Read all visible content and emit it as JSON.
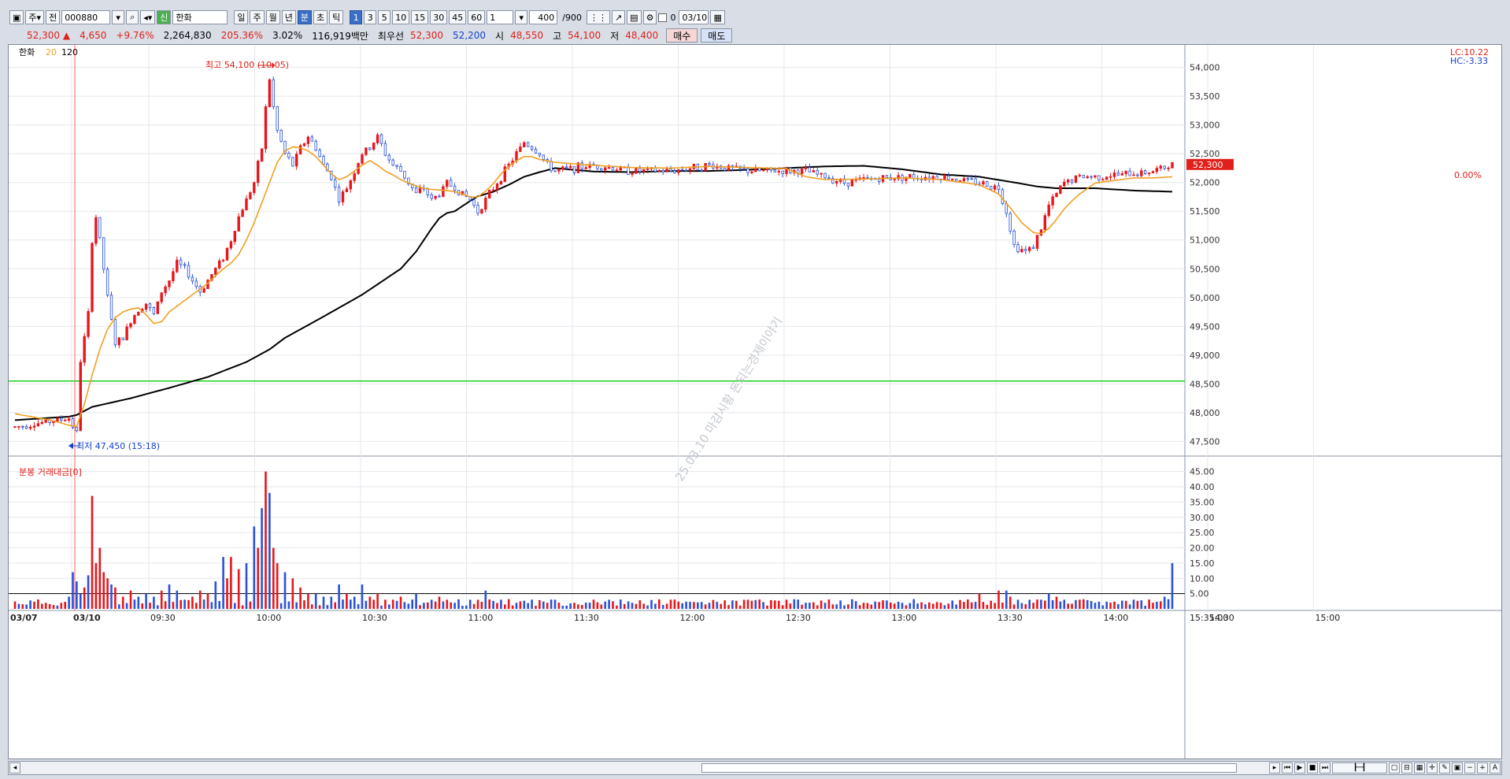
{
  "toolbar": {
    "period_type": "주",
    "mode": "전",
    "code": "000880",
    "name_tag": "신",
    "stock_name": "한화",
    "periods": [
      "일",
      "주",
      "월",
      "년",
      "분",
      "초",
      "틱"
    ],
    "active_period": "분",
    "intervals": [
      "1",
      "3",
      "5",
      "10",
      "15",
      "30",
      "45",
      "60"
    ],
    "active_interval": "1",
    "interval_select": "1",
    "count": "400",
    "count_total": "/900",
    "checkbox_label": "0",
    "date": "03/10"
  },
  "quote": {
    "price": "52,300",
    "arrow": "▲",
    "change": "4,650",
    "change_pct": "+9.76%",
    "volume": "2,264,830",
    "volume_ratio": "205.36%",
    "turnover": "3.02%",
    "amount": "116,919백만",
    "best_label": "최우선",
    "best_ask": "52,300",
    "best_bid": "52,200",
    "open_label": "시",
    "open": "48,550",
    "high_label": "고",
    "high": "54,100",
    "low_label": "저",
    "low": "48,400",
    "buy_label": "매수",
    "sell_label": "매도"
  },
  "legend": {
    "name": "한화",
    "ma_short": "20",
    "ma_long": "120"
  },
  "annotations": {
    "high": "최고 54,100 (10:05)",
    "low": "최저 47,450 (15:18)",
    "lc": "LC:10.22",
    "hc": "HC:-3.33",
    "current_price": "52,300",
    "current_pct": "0.00%",
    "watermark": "25.03.10 마감시황 돈되는경제이야기"
  },
  "volume_panel": {
    "title": "분봉 거래대금[0]"
  },
  "colors": {
    "up": "#e8161a",
    "down": "#2a52d8",
    "ma_short": "#f0a020",
    "ma_long": "#000000",
    "hline": "#19d219"
  },
  "chart_data": {
    "type": "candlestick",
    "price_axis": {
      "ticks": [
        "54,000",
        "53,500",
        "53,000",
        "52,500",
        "52,000",
        "51,500",
        "51,000",
        "50,500",
        "50,000",
        "49,500",
        "49,000",
        "48,500",
        "48,000",
        "47,500"
      ],
      "ylim": [
        47300,
        54200
      ]
    },
    "volume_axis": {
      "ticks": [
        "45.00",
        "40.00",
        "35.00",
        "30.00",
        "25.00",
        "20.00",
        "15.00",
        "10.00",
        "5.00"
      ],
      "ylim": [
        0,
        48
      ]
    },
    "time_labels": [
      "03/07",
      "03/10",
      "09:30",
      "10:00",
      "10:30",
      "11:00",
      "11:30",
      "12:00",
      "12:30",
      "13:00",
      "13:30",
      "14:00",
      "14:30",
      "15:00",
      "15:35:00"
    ],
    "horizontal_line": 48550,
    "volume_reference_line": 5,
    "high_marker": {
      "time": "10:05",
      "price": 54100
    },
    "low_marker": {
      "time": "15:18",
      "price": 47450
    },
    "close_path": [
      [
        0,
        47750
      ],
      [
        14,
        47900
      ],
      [
        16,
        47650
      ],
      [
        17,
        48900
      ],
      [
        18,
        49300
      ],
      [
        19,
        49700
      ],
      [
        20,
        51000
      ],
      [
        21,
        51400
      ],
      [
        22,
        51000
      ],
      [
        23,
        50500
      ],
      [
        24,
        50000
      ],
      [
        26,
        49200
      ],
      [
        28,
        49300
      ],
      [
        30,
        49600
      ],
      [
        32,
        49800
      ],
      [
        34,
        49900
      ],
      [
        36,
        49700
      ],
      [
        38,
        50100
      ],
      [
        40,
        50300
      ],
      [
        42,
        50600
      ],
      [
        44,
        50500
      ],
      [
        46,
        50300
      ],
      [
        48,
        50100
      ],
      [
        50,
        50300
      ],
      [
        52,
        50500
      ],
      [
        54,
        50700
      ],
      [
        56,
        51000
      ],
      [
        58,
        51400
      ],
      [
        60,
        51700
      ],
      [
        62,
        52000
      ],
      [
        63,
        52300
      ],
      [
        64,
        52600
      ],
      [
        65,
        53300
      ],
      [
        66,
        53800
      ],
      [
        67,
        53300
      ],
      [
        68,
        52900
      ],
      [
        70,
        52500
      ],
      [
        72,
        52300
      ],
      [
        74,
        52600
      ],
      [
        76,
        52800
      ],
      [
        78,
        52600
      ],
      [
        80,
        52300
      ],
      [
        82,
        52100
      ],
      [
        84,
        51700
      ],
      [
        86,
        51900
      ],
      [
        88,
        52200
      ],
      [
        90,
        52500
      ],
      [
        92,
        52600
      ],
      [
        94,
        52800
      ],
      [
        96,
        52500
      ],
      [
        98,
        52300
      ],
      [
        100,
        52200
      ],
      [
        102,
        52000
      ],
      [
        104,
        51800
      ],
      [
        106,
        51900
      ],
      [
        108,
        51700
      ],
      [
        110,
        51800
      ],
      [
        112,
        52000
      ],
      [
        114,
        51900
      ],
      [
        116,
        51800
      ],
      [
        118,
        51700
      ],
      [
        120,
        51500
      ],
      [
        122,
        51700
      ],
      [
        124,
        51900
      ],
      [
        126,
        52100
      ],
      [
        128,
        52300
      ],
      [
        130,
        52500
      ],
      [
        132,
        52700
      ],
      [
        134,
        52600
      ],
      [
        136,
        52500
      ],
      [
        138,
        52300
      ],
      [
        140,
        52200
      ],
      [
        150,
        52300
      ],
      [
        160,
        52200
      ],
      [
        170,
        52200
      ],
      [
        180,
        52300
      ],
      [
        190,
        52200
      ],
      [
        200,
        52200
      ],
      [
        205,
        52200
      ],
      [
        210,
        52100
      ],
      [
        215,
        52000
      ],
      [
        220,
        52050
      ],
      [
        230,
        52100
      ],
      [
        240,
        52100
      ],
      [
        250,
        52000
      ],
      [
        255,
        51900
      ],
      [
        257,
        51500
      ],
      [
        258,
        51200
      ],
      [
        259,
        50900
      ],
      [
        262,
        50800
      ],
      [
        264,
        50900
      ],
      [
        266,
        51200
      ],
      [
        268,
        51600
      ],
      [
        270,
        51800
      ],
      [
        272,
        52000
      ],
      [
        276,
        52100
      ],
      [
        280,
        52100
      ],
      [
        290,
        52150
      ],
      [
        295,
        52200
      ],
      [
        300,
        52300
      ]
    ],
    "ma20_path": [
      [
        0,
        47980
      ],
      [
        10,
        47860
      ],
      [
        14,
        47780
      ],
      [
        16,
        47760
      ],
      [
        18,
        48150
      ],
      [
        20,
        48650
      ],
      [
        22,
        49100
      ],
      [
        24,
        49450
      ],
      [
        26,
        49650
      ],
      [
        28,
        49750
      ],
      [
        30,
        49800
      ],
      [
        32,
        49820
      ],
      [
        34,
        49700
      ],
      [
        36,
        49550
      ],
      [
        38,
        49580
      ],
      [
        40,
        49750
      ],
      [
        42,
        49850
      ],
      [
        44,
        49950
      ],
      [
        46,
        50050
      ],
      [
        48,
        50150
      ],
      [
        50,
        50250
      ],
      [
        52,
        50380
      ],
      [
        54,
        50500
      ],
      [
        56,
        50600
      ],
      [
        58,
        50750
      ],
      [
        60,
        51000
      ],
      [
        62,
        51300
      ],
      [
        64,
        51650
      ],
      [
        66,
        52000
      ],
      [
        68,
        52350
      ],
      [
        70,
        52550
      ],
      [
        72,
        52620
      ],
      [
        74,
        52600
      ],
      [
        76,
        52550
      ],
      [
        78,
        52450
      ],
      [
        80,
        52300
      ],
      [
        82,
        52150
      ],
      [
        84,
        52050
      ],
      [
        86,
        52100
      ],
      [
        88,
        52200
      ],
      [
        90,
        52300
      ],
      [
        92,
        52380
      ],
      [
        94,
        52300
      ],
      [
        96,
        52200
      ],
      [
        98,
        52130
      ],
      [
        100,
        52050
      ],
      [
        102,
        51990
      ],
      [
        104,
        51940
      ],
      [
        106,
        51900
      ],
      [
        108,
        51880
      ],
      [
        110,
        51870
      ],
      [
        112,
        51860
      ],
      [
        114,
        51840
      ],
      [
        116,
        51800
      ],
      [
        118,
        51750
      ],
      [
        120,
        51750
      ],
      [
        122,
        51850
      ],
      [
        124,
        51980
      ],
      [
        126,
        52150
      ],
      [
        128,
        52280
      ],
      [
        130,
        52380
      ],
      [
        132,
        52450
      ],
      [
        134,
        52450
      ],
      [
        136,
        52400
      ],
      [
        140,
        52350
      ],
      [
        150,
        52300
      ],
      [
        160,
        52260
      ],
      [
        170,
        52250
      ],
      [
        180,
        52280
      ],
      [
        190,
        52260
      ],
      [
        200,
        52240
      ],
      [
        205,
        52100
      ],
      [
        210,
        52050
      ],
      [
        220,
        52060
      ],
      [
        230,
        52080
      ],
      [
        240,
        52050
      ],
      [
        250,
        51960
      ],
      [
        255,
        51800
      ],
      [
        258,
        51560
      ],
      [
        261,
        51300
      ],
      [
        264,
        51130
      ],
      [
        266,
        51110
      ],
      [
        268,
        51200
      ],
      [
        270,
        51360
      ],
      [
        272,
        51540
      ],
      [
        274,
        51680
      ],
      [
        276,
        51800
      ],
      [
        280,
        51990
      ],
      [
        290,
        52080
      ],
      [
        295,
        52080
      ],
      [
        300,
        52100
      ]
    ],
    "ma120_path": [
      [
        0,
        47870
      ],
      [
        14,
        47930
      ],
      [
        16,
        47960
      ],
      [
        20,
        48100
      ],
      [
        30,
        48250
      ],
      [
        40,
        48430
      ],
      [
        50,
        48620
      ],
      [
        60,
        48880
      ],
      [
        66,
        49100
      ],
      [
        70,
        49300
      ],
      [
        80,
        49670
      ],
      [
        90,
        50050
      ],
      [
        100,
        50500
      ],
      [
        104,
        50800
      ],
      [
        106,
        51000
      ],
      [
        108,
        51200
      ],
      [
        110,
        51380
      ],
      [
        112,
        51470
      ],
      [
        114,
        51500
      ],
      [
        118,
        51680
      ],
      [
        120,
        51760
      ],
      [
        124,
        51840
      ],
      [
        128,
        51960
      ],
      [
        132,
        52100
      ],
      [
        136,
        52180
      ],
      [
        140,
        52250
      ],
      [
        150,
        52190
      ],
      [
        160,
        52180
      ],
      [
        170,
        52200
      ],
      [
        180,
        52200
      ],
      [
        190,
        52220
      ],
      [
        200,
        52250
      ],
      [
        210,
        52280
      ],
      [
        220,
        52290
      ],
      [
        230,
        52230
      ],
      [
        240,
        52140
      ],
      [
        250,
        52100
      ],
      [
        260,
        51990
      ],
      [
        265,
        51930
      ],
      [
        270,
        51900
      ],
      [
        280,
        51900
      ],
      [
        290,
        51860
      ],
      [
        300,
        51840
      ]
    ],
    "volume_peaks": [
      [
        14,
        4
      ],
      [
        15,
        12
      ],
      [
        16,
        9
      ],
      [
        17,
        5
      ],
      [
        18,
        7
      ],
      [
        19,
        11
      ],
      [
        20,
        37
      ],
      [
        21,
        15
      ],
      [
        22,
        20
      ],
      [
        23,
        12
      ],
      [
        24,
        10
      ],
      [
        25,
        8
      ],
      [
        26,
        7
      ],
      [
        28,
        4
      ],
      [
        30,
        6
      ],
      [
        32,
        4
      ],
      [
        34,
        5
      ],
      [
        36,
        4
      ],
      [
        38,
        6
      ],
      [
        40,
        8
      ],
      [
        42,
        6
      ],
      [
        44,
        3
      ],
      [
        46,
        4
      ],
      [
        48,
        6
      ],
      [
        50,
        5
      ],
      [
        52,
        9
      ],
      [
        54,
        17
      ],
      [
        55,
        10
      ],
      [
        56,
        17
      ],
      [
        58,
        13
      ],
      [
        60,
        15
      ],
      [
        62,
        27
      ],
      [
        63,
        20
      ],
      [
        64,
        33
      ],
      [
        65,
        45
      ],
      [
        66,
        38
      ],
      [
        67,
        20
      ],
      [
        68,
        15
      ],
      [
        70,
        12
      ],
      [
        72,
        10
      ],
      [
        74,
        7
      ],
      [
        76,
        5
      ],
      [
        78,
        5
      ],
      [
        80,
        4
      ],
      [
        82,
        4
      ],
      [
        84,
        8
      ],
      [
        86,
        5
      ],
      [
        88,
        4
      ],
      [
        90,
        8
      ],
      [
        92,
        4
      ],
      [
        94,
        5
      ],
      [
        96,
        3
      ],
      [
        98,
        3
      ],
      [
        100,
        4
      ],
      [
        104,
        5
      ],
      [
        106,
        2
      ],
      [
        108,
        3
      ],
      [
        110,
        4
      ],
      [
        112,
        3
      ],
      [
        114,
        2
      ],
      [
        118,
        3
      ],
      [
        122,
        6
      ],
      [
        126,
        3
      ],
      [
        130,
        2
      ],
      [
        134,
        3
      ],
      [
        138,
        2
      ],
      [
        140,
        3
      ],
      [
        145,
        2
      ],
      [
        150,
        3
      ],
      [
        160,
        2
      ],
      [
        170,
        3
      ],
      [
        180,
        2
      ],
      [
        190,
        3
      ],
      [
        200,
        3
      ],
      [
        205,
        2
      ],
      [
        210,
        2
      ],
      [
        220,
        2
      ],
      [
        230,
        2
      ],
      [
        240,
        2
      ],
      [
        250,
        5
      ],
      [
        255,
        6
      ],
      [
        257,
        6
      ],
      [
        258,
        4
      ],
      [
        260,
        3
      ],
      [
        264,
        2
      ],
      [
        266,
        3
      ],
      [
        268,
        5
      ],
      [
        270,
        4
      ],
      [
        272,
        3
      ],
      [
        276,
        3
      ],
      [
        280,
        2
      ],
      [
        290,
        3
      ],
      [
        295,
        2
      ],
      [
        298,
        4
      ],
      [
        300,
        15
      ]
    ]
  }
}
